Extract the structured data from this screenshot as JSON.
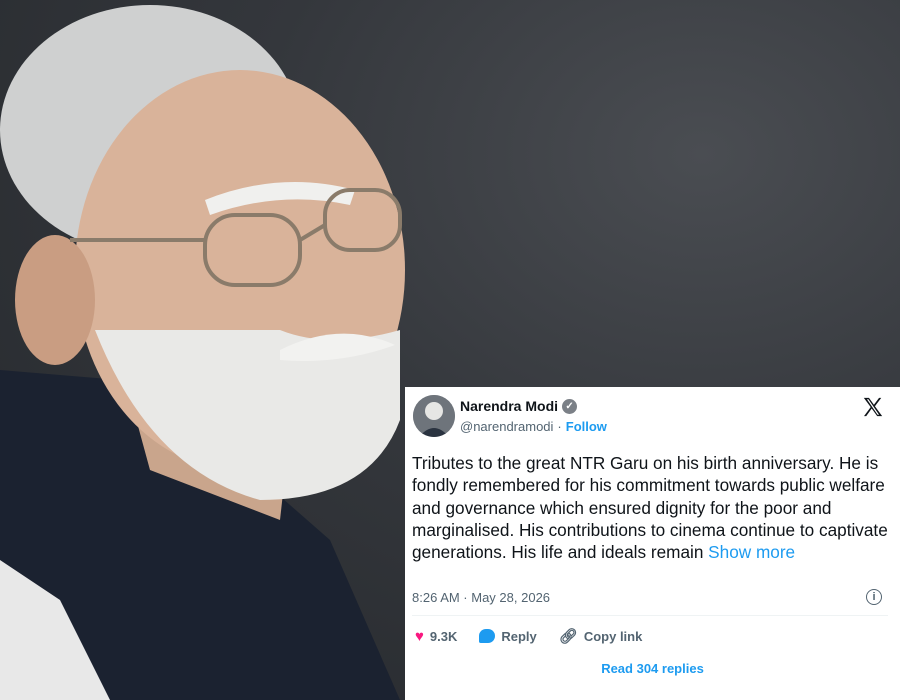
{
  "photo": {
    "subject": "portrait-photo"
  },
  "tweet": {
    "author_name": "Narendra Modi",
    "handle": "@narendramodi",
    "separator": "·",
    "follow_label": "Follow",
    "text": "Tributes to the great NTR Garu on his birth anniversary. He is fondly remembered for his commitment towards public welfare and governance which ensured dignity for the poor and marginalised. His contributions to cinema continue to captivate generations. His life and ideals remain",
    "show_more_label": "Show more",
    "timestamp": "8:26 AM · May 28, 2026",
    "likes": "9.3K",
    "reply_label": "Reply",
    "copy_link_label": "Copy link",
    "read_replies_label": "Read 304 replies",
    "icons": {
      "verified": "verified-badge-icon",
      "platform": "x-logo-icon",
      "info": "info-icon",
      "like": "heart-icon",
      "reply": "reply-bubble-icon",
      "link": "link-icon"
    },
    "colors": {
      "accent": "#1d9bf0",
      "like": "#f91880",
      "muted": "#536471"
    }
  }
}
